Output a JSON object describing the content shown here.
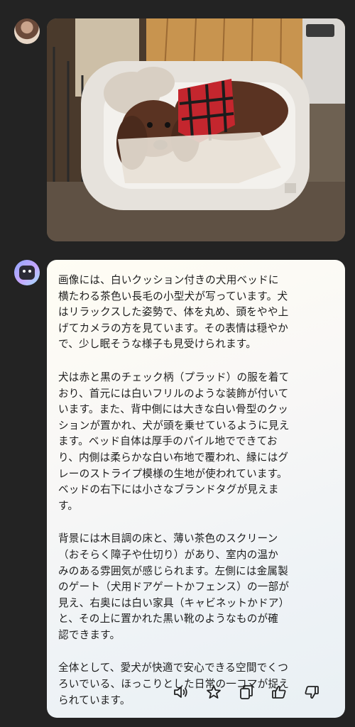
{
  "chat": {
    "user_message": {
      "avatar_icon": "user-avatar-photo",
      "image_description_icon": "dog-bed-photo"
    },
    "assistant_message": {
      "avatar_icon": "assistant-avatar",
      "paragraphs": [
        "画像には、白いクッション付きの犬用ベッドに\n横たわる茶色い長毛の小型犬が写っています。犬\nはリラックスした姿勢で、体を丸め、頭をやや上\nげてカメラの方を見ています。その表情は穏やか\nで、少し眠そうな様子も見受けられます。",
        "犬は赤と黒のチェック柄（プラッド）の服を着て\nおり、首元には白いフリルのような装飾が付いて\nいます。また、背中側には大きな白い骨型のクッ\nションが置かれ、犬が頭を乗せているように見え\nます。ベッド自体は厚手のパイル地でできてお\nり、内側は柔らかな白い布地で覆われ、縁にはグ\nレーのストライプ模様の生地が使われています。\nベッドの右下には小さなブランドタグが見えま\nす。",
        "背景には木目調の床と、薄い茶色のスクリーン\n（おそらく障子や仕切り）があり、室内の温か\nみのある雰囲気が感じられます。左側には金属製\nのゲート（犬用ドアゲートかフェンス）の一部が\n見え、右奥には白い家具（キャビネットかドア）\nと、その上に置かれた黒い靴のようなものが確\n認できます。",
        "全体として、愛犬が快適で安心できる空間でくつ\nろいでいる、ほっこりとした日常の一コマが捉え\nられています。"
      ],
      "actions": [
        {
          "name": "read-aloud",
          "icon": "speaker-icon"
        },
        {
          "name": "favorite",
          "icon": "star-icon"
        },
        {
          "name": "copy",
          "icon": "copy-icon"
        },
        {
          "name": "like",
          "icon": "thumbs-up-icon"
        },
        {
          "name": "dislike",
          "icon": "thumbs-down-icon"
        }
      ]
    }
  },
  "colors": {
    "background": "#232323",
    "bubble": "#f8f7f6",
    "text": "#1d1d1d"
  }
}
